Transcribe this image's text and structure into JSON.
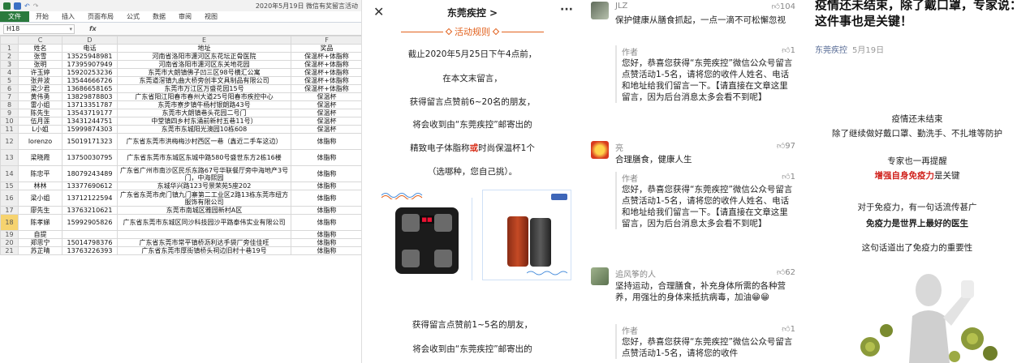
{
  "excel": {
    "title": "2020年5月19日 微信有奖留言活动",
    "ribbon_tabs": [
      "文件",
      "开始",
      "插入",
      "页面布局",
      "公式",
      "数据",
      "审阅",
      "视图"
    ],
    "name_box": "H18",
    "fx_label": "fx",
    "columns": [
      "C",
      "D",
      "E",
      "F"
    ],
    "rows": [
      {
        "n": "1",
        "name": "姓名",
        "phone": "电话",
        "address": "地址",
        "prize": "奖品"
      },
      {
        "n": "2",
        "name": "张雪",
        "phone": "13525948981",
        "address": "河南省洛阳市瀍河区东花坛正骨医院",
        "prize": "保温杯+体脂称"
      },
      {
        "n": "3",
        "name": "张明",
        "phone": "17395907949",
        "address": "河南省洛阳市瀍河区东关地花园",
        "prize": "保温杯+体脂称"
      },
      {
        "n": "4",
        "name": "许玉婷",
        "phone": "15920253236",
        "address": "东莞市大朗镇佛子凹三区98号横汇公寓",
        "prize": "保温杯+体脂称"
      },
      {
        "n": "5",
        "name": "张井波",
        "phone": "13544666726",
        "address": "东莞道滘镇九曲大桥旁创丰文具制品有限公司",
        "prize": "保温杯+体脂称"
      },
      {
        "n": "6",
        "name": "梁少君",
        "phone": "13686658165",
        "address": "东莞市万江区万盛花园15号",
        "prize": "保温杯+体脂称"
      },
      {
        "n": "7",
        "name": "黄伟勇",
        "phone": "13829878803",
        "address": "广东省阳江阳春市春州大道25号阳春市疾控中心",
        "prize": "保温杯"
      },
      {
        "n": "8",
        "name": "雷小姐",
        "phone": "13713351787",
        "address": "东莞市寮步镇牛杨村银朗路43号",
        "prize": "保温杯"
      },
      {
        "n": "9",
        "name": "陈先生",
        "phone": "13543719177",
        "address": "东莞市大朗镇巷头花园二号门",
        "prize": "保温杯"
      },
      {
        "n": "10",
        "name": "伍月莲",
        "phone": "13431244751",
        "address": "中堂镇四乡村东涌前新村五巷11号）",
        "prize": "保温杯"
      },
      {
        "n": "11",
        "name": "L小姐",
        "phone": "15999874303",
        "address": "东莞市东城阳光澳园10栋608",
        "prize": "保温杯"
      },
      {
        "n": "12",
        "name": "lorenzo",
        "phone": "15019171323",
        "address": "广东省东莞市洪梅梅沙村西区一巷（鑫近二手车这边）",
        "prize": "体脂称"
      },
      {
        "n": "13",
        "name": "梁晓霞",
        "phone": "13750030795",
        "address": "广东省东莞市东城区东城中路580号盛世东方2栋16楼",
        "prize": "体脂称"
      },
      {
        "n": "14",
        "name": "陈忠平",
        "phone": "18079243489",
        "address": "广东省广州市南沙区民乐东路67号华联餐厅旁中海地产3号门，中海熙园",
        "prize": "体脂称"
      },
      {
        "n": "15",
        "name": "林林",
        "phone": "13377690612",
        "address": "东城华兴路123号景荣苑5座202",
        "prize": "体脂称"
      },
      {
        "n": "16",
        "name": "梁小姐",
        "phone": "13712122594",
        "address": "广东省东莞市虎门镇九门寨第二工业区2路13栋东莞市纽方服饰有限公司",
        "prize": "体脂称"
      },
      {
        "n": "17",
        "name": "廖先生",
        "phone": "13763210621",
        "address": "东莞市南城区雅园新村A区",
        "prize": "体脂称"
      },
      {
        "n": "18",
        "name": "陈孝娣",
        "phone": "15992905826",
        "address": "广东省东莞市东城区同沙科技园沙平路泰伟实业有限公司",
        "prize": "体脂称"
      },
      {
        "n": "19",
        "name": "自提",
        "phone": "",
        "address": "",
        "prize": "体脂称"
      },
      {
        "n": "20",
        "name": "郑思宁",
        "phone": "15014798376",
        "address": "广东省东莞市常平镇桥沥利达手袋厂旁佳佳旺",
        "prize": "体脂称"
      },
      {
        "n": "21",
        "name": "苏芷晴",
        "phone": "13763226393",
        "address": "广东省东莞市厚街镇桥头祠边旧村十巷19号",
        "prize": "体脂称"
      }
    ]
  },
  "article": {
    "nav_title": "东莞疾控 >",
    "close_glyph": "✕",
    "more_glyph": "···",
    "section_title": "活动规则",
    "p1": "截止2020年5月25日下午4点前，",
    "p2": "在本文末留言，",
    "p3": "获得留言点赞前6~20名的朋友，",
    "p4": "将会收到由“东莞疾控”邮寄出的",
    "p5a": "精致电子体脂称",
    "p5b": "或",
    "p5c": "时尚保温杯1个",
    "p6": "（选哪种，您自己挑）。",
    "p7": "获得留言点赞前1~5名的朋友，",
    "p8": "将会收到由“东莞疾控”邮寄出的"
  },
  "comments": [
    {
      "name": "JLZ",
      "likes": "104",
      "text": "保护健康从膳食抓起，一点一滴不可松懈忽视",
      "reply_author": "作者",
      "reply_likes": "1",
      "reply_text": "您好，恭喜您获得“东莞疾控”微信公众号留言点赞活动1-5名，请将您的收件人姓名、电话和地址给我们留言一下。【请直接在文章这里留言，因为后台消息太多会看不到呢】"
    },
    {
      "name": "亮",
      "likes": "97",
      "text": "合理膳食，健康人生",
      "reply_author": "作者",
      "reply_likes": "1",
      "reply_text": "您好，恭喜您获得“东莞疾控”微信公众号留言点赞活动1-5名，请将您的收件人姓名、电话和地址给我们留言一下。【请直接在文章这里留言，因为后台消息太多会看不到呢】"
    },
    {
      "name": "追风筝的人",
      "likes": "62",
      "text": "坚持运动，合理膳食，补充身体所需的各种营养，用强壮的身体来抵抗病毒，加油😁😁",
      "reply_author": "作者",
      "reply_likes": "1",
      "reply_text": "您好，恭喜您获得“东莞疾控”微信公众号留言点赞活动1-5名，请将您的收件"
    }
  ],
  "news": {
    "title": "疫情还未结束，除了戴口罩，专家说：这件事也是关键！",
    "source": "东莞疾控",
    "date": "5月19日",
    "l1": "疫情还未结束",
    "l2": "除了继续做好戴口罩、勤洗手、不扎堆等防护",
    "l3": "专家也一再提醒",
    "l4": "增强自身免疫力",
    "l4b": "是关键",
    "l5": "对于免疫力，有一句话流传甚广",
    "l6": "免疫力是世界上最好的医生",
    "l7": "这句话道出了免疫力的重要性"
  },
  "colors": {
    "excel_green": "#2a7a3d",
    "accent_orange": "#e2611d",
    "highlight_red": "#d8321d",
    "link_blue": "#576b95"
  }
}
